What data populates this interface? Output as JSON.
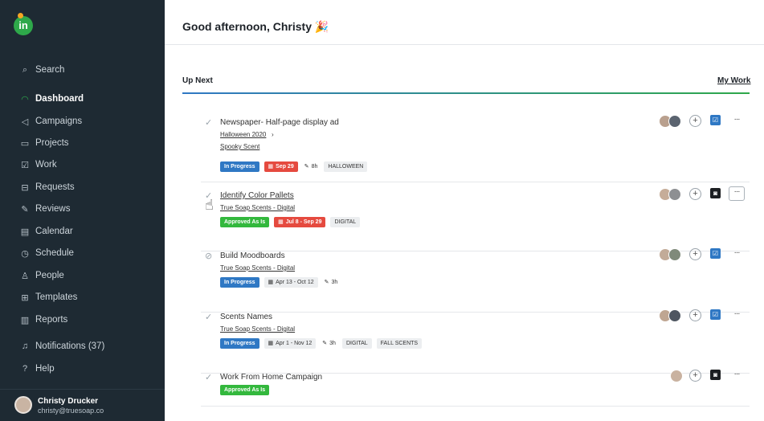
{
  "app": {
    "logo_text": "in",
    "greeting": "Good afternoon, Christy",
    "greeting_emoji": "🎉"
  },
  "sidebar": {
    "items": [
      {
        "label": "Search",
        "icon": "search-icon",
        "glyph": "⌕"
      },
      {
        "label": "Dashboard",
        "icon": "dashboard-icon",
        "glyph": "◠",
        "active": true
      },
      {
        "label": "Campaigns",
        "icon": "megaphone-icon",
        "glyph": "◁"
      },
      {
        "label": "Projects",
        "icon": "folder-icon",
        "glyph": "▭"
      },
      {
        "label": "Work",
        "icon": "checkbox-icon",
        "glyph": "☑"
      },
      {
        "label": "Requests",
        "icon": "inbox-icon",
        "glyph": "⊟"
      },
      {
        "label": "Reviews",
        "icon": "review-icon",
        "glyph": "✎"
      },
      {
        "label": "Calendar",
        "icon": "calendar-icon",
        "glyph": "▤"
      },
      {
        "label": "Schedule",
        "icon": "clock-icon",
        "glyph": "◷"
      },
      {
        "label": "People",
        "icon": "person-icon",
        "glyph": "♙"
      },
      {
        "label": "Templates",
        "icon": "template-icon",
        "glyph": "⊞"
      },
      {
        "label": "Reports",
        "icon": "chart-icon",
        "glyph": "▥"
      },
      {
        "label": "Notifications (37)",
        "icon": "bell-icon",
        "glyph": "♫"
      },
      {
        "label": "Help",
        "icon": "help-icon",
        "glyph": "?"
      }
    ],
    "user": {
      "name": "Christy Drucker",
      "email": "christy@truesoap.co"
    }
  },
  "section": {
    "title": "Up Next",
    "link": "My Work"
  },
  "tasks": [
    {
      "title": "Newspaper- Half-page display ad",
      "title_underlined": false,
      "check": "✓",
      "subs": [
        "Halloween 2020",
        "Spooky Scent"
      ],
      "sub_chevron": "›",
      "tags": [
        {
          "text": "In Progress",
          "style": "blue"
        },
        {
          "text": "Sep 29",
          "style": "red",
          "icon": "calendar-overdue-icon"
        },
        {
          "text": "8h",
          "style": "plain",
          "icon": "pencil-icon"
        },
        {
          "text": "HALLOWEEN",
          "style": "grey"
        }
      ],
      "action_icon": "review-square-icon",
      "action_style": "b",
      "more_boxed": false
    },
    {
      "title": "Identify Color Pallets",
      "title_underlined": true,
      "check": "✓",
      "subs": [
        "True Soap Scents - Digital"
      ],
      "tags": [
        {
          "text": "Approved As Is",
          "style": "green"
        },
        {
          "text": "Jul 8 - Sep 29",
          "style": "red",
          "icon": "calendar-icon"
        },
        {
          "text": "DIGITAL",
          "style": "grey"
        }
      ],
      "action_icon": "proof-square-icon",
      "action_style": "k",
      "more_boxed": true
    },
    {
      "title": "Build Moodboards",
      "title_underlined": false,
      "check": "⊘",
      "subs": [
        "True Soap Scents - Digital"
      ],
      "tags": [
        {
          "text": "In Progress",
          "style": "blue"
        },
        {
          "text": "Apr 13 - Oct 12",
          "style": "grey",
          "icon": "calendar-icon"
        },
        {
          "text": "3h",
          "style": "plain",
          "icon": "pencil-icon"
        }
      ],
      "action_icon": "review-square-icon",
      "action_style": "b",
      "more_boxed": false
    },
    {
      "title": "Scents Names",
      "title_underlined": false,
      "check": "✓",
      "subs": [
        "True Soap Scents - Digital"
      ],
      "tags": [
        {
          "text": "In Progress",
          "style": "blue"
        },
        {
          "text": "Apr 1 - Nov 12",
          "style": "grey",
          "icon": "calendar-icon"
        },
        {
          "text": "3h",
          "style": "plain",
          "icon": "pencil-icon"
        },
        {
          "text": "DIGITAL",
          "style": "grey"
        },
        {
          "text": "FALL SCENTS",
          "style": "grey"
        }
      ],
      "action_icon": "review-square-icon",
      "action_style": "b",
      "more_boxed": false
    },
    {
      "title": "Work From Home Campaign",
      "title_underlined": false,
      "check": "✓",
      "subs": [],
      "tags": [
        {
          "text": "Approved As Is",
          "style": "green"
        }
      ],
      "action_icon": "proof-square-icon",
      "action_style": "k",
      "more_boxed": false,
      "single_avatar": true
    }
  ],
  "glyphs": {
    "plus": "+",
    "more": "···",
    "pencil": "✎",
    "calendar": "▦"
  },
  "colors": {
    "sidebar": "#1e2a33",
    "accent_green": "#2ea84a",
    "status_blue": "#2f78c4",
    "status_red": "#e54a3f"
  }
}
